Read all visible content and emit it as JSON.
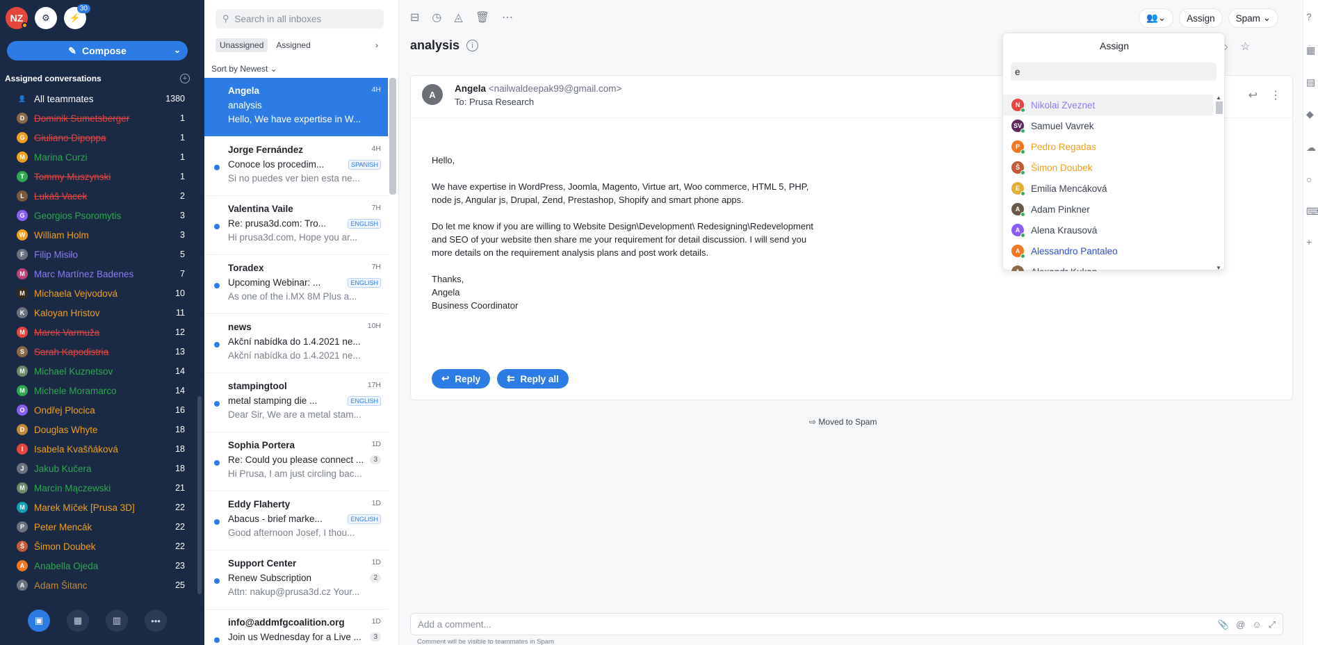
{
  "user": {
    "initials": "NZ",
    "bolt_badge": "30"
  },
  "compose_label": "Compose",
  "assigned_header": "Assigned conversations",
  "teammates": [
    {
      "initial": "",
      "name": "All teammates",
      "count": "1380",
      "color": "#ffffff",
      "av": "#1b2a44",
      "strike": false
    },
    {
      "initial": "D",
      "name": "Dominik Sumetsberger",
      "count": "1",
      "color": "#e64540",
      "av": "#8a6a4a",
      "strike": true
    },
    {
      "initial": "G",
      "name": "Giuliano Dipoppa",
      "count": "1",
      "color": "#e64540",
      "av": "#f0a020",
      "strike": true
    },
    {
      "initial": "M",
      "name": "Marina Curzi",
      "count": "1",
      "color": "#2fa84f",
      "av": "#f0a020",
      "strike": false
    },
    {
      "initial": "T",
      "name": "Tommy Muszynski",
      "count": "1",
      "color": "#e64540",
      "av": "#2fa84f",
      "strike": true
    },
    {
      "initial": "L",
      "name": "Lukáš Vacek",
      "count": "2",
      "color": "#e64540",
      "av": "#7a5a3a",
      "strike": true
    },
    {
      "initial": "G",
      "name": "Georgios Psoromytis",
      "count": "3",
      "color": "#2fa84f",
      "av": "#8b5cf6",
      "strike": false
    },
    {
      "initial": "W",
      "name": "William Holm",
      "count": "3",
      "color": "#f0a020",
      "av": "#f0a020",
      "strike": false
    },
    {
      "initial": "F",
      "name": "Filip Misiło",
      "count": "5",
      "color": "#8b7cf6",
      "av": "#6b7280",
      "strike": false
    },
    {
      "initial": "M",
      "name": "Marc Martínez Badenes",
      "count": "7",
      "color": "#8b7cf6",
      "av": "#c2407a",
      "strike": false
    },
    {
      "initial": "M",
      "name": "Michaela Vejvodová",
      "count": "10",
      "color": "#f0a020",
      "av": "#3a2a1a",
      "strike": false
    },
    {
      "initial": "K",
      "name": "Kaloyan Hristov",
      "count": "11",
      "color": "#f0a020",
      "av": "#6b7280",
      "strike": false
    },
    {
      "initial": "M",
      "name": "Marek Varmuža",
      "count": "12",
      "color": "#e64540",
      "av": "#e64540",
      "strike": true
    },
    {
      "initial": "S",
      "name": "Sarah Kapodistria",
      "count": "13",
      "color": "#e64540",
      "av": "#8a6a4a",
      "strike": true
    },
    {
      "initial": "M",
      "name": "Michael Kuznetsov",
      "count": "14",
      "color": "#2fa84f",
      "av": "#6b8a6a",
      "strike": false
    },
    {
      "initial": "M",
      "name": "Michele Moramarco",
      "count": "14",
      "color": "#2fa84f",
      "av": "#2fa84f",
      "strike": false
    },
    {
      "initial": "O",
      "name": "Ondřej Plocica",
      "count": "16",
      "color": "#f0a020",
      "av": "#8b5cf6",
      "strike": false
    },
    {
      "initial": "D",
      "name": "Douglas Whyte",
      "count": "18",
      "color": "#f0a020",
      "av": "#c28a3a",
      "strike": false
    },
    {
      "initial": "I",
      "name": "Isabela Kvašňáková",
      "count": "18",
      "color": "#f0a020",
      "av": "#e64540",
      "strike": false
    },
    {
      "initial": "J",
      "name": "Jakub Kučera",
      "count": "18",
      "color": "#2fa84f",
      "av": "#6b7280",
      "strike": false
    },
    {
      "initial": "M",
      "name": "Marcin Mączewski",
      "count": "21",
      "color": "#2fa84f",
      "av": "#6b8a6a",
      "strike": false
    },
    {
      "initial": "M",
      "name": "Marek Míček [Prusa 3D]",
      "count": "22",
      "color": "#f0a020",
      "av": "#14a0b4",
      "strike": false
    },
    {
      "initial": "P",
      "name": "Peter Mencák",
      "count": "22",
      "color": "#f0a020",
      "av": "#6b7280",
      "strike": false
    },
    {
      "initial": "Š",
      "name": "Šimon Doubek",
      "count": "22",
      "color": "#f0a020",
      "av": "#c25a3a",
      "strike": false
    },
    {
      "initial": "A",
      "name": "Anabella Ojeda",
      "count": "23",
      "color": "#2fa84f",
      "av": "#f07820",
      "strike": false
    },
    {
      "initial": "A",
      "name": "Adam Šitanc",
      "count": "25",
      "color": "#c28a3a",
      "av": "#6b7280",
      "strike": false
    }
  ],
  "search_placeholder": "Search in all inboxes",
  "filter_tabs": [
    "Unassigned",
    "Assigned"
  ],
  "sort_label": "Sort by Newest",
  "conversations": [
    {
      "from": "Angela",
      "time": "4H",
      "subject": "analysis",
      "preview": "Hello, We have expertise in W...",
      "tag": "",
      "count": "",
      "selected": true,
      "unread": false
    },
    {
      "from": "Jorge Fernández",
      "time": "4H",
      "subject": "Conoce los procedim...",
      "preview": "Si no puedes ver bien esta ne...",
      "tag": "SPANISH",
      "count": "",
      "selected": false,
      "unread": true
    },
    {
      "from": "Valentina Vaile",
      "time": "7H",
      "subject": "Re: prusa3d.com: Tro...",
      "preview": "Hi prusa3d.com, Hope you ar...",
      "tag": "ENGLISH",
      "count": "",
      "selected": false,
      "unread": true
    },
    {
      "from": "Toradex",
      "time": "7H",
      "subject": "Upcoming Webinar: ...",
      "preview": "As one of the i.MX 8M Plus a...",
      "tag": "ENGLISH",
      "count": "",
      "selected": false,
      "unread": true
    },
    {
      "from": "news",
      "time": "10H",
      "subject": "Akční nabídka do 1.4.2021 ne...",
      "preview": "Akční nabídka do 1.4.2021 ne...",
      "tag": "",
      "count": "",
      "selected": false,
      "unread": true
    },
    {
      "from": "stampingtool",
      "time": "17H",
      "subject": "metal stamping die ...",
      "preview": "Dear Sir, We are a metal stam...",
      "tag": "ENGLISH",
      "count": "",
      "selected": false,
      "unread": true
    },
    {
      "from": "Sophia Portera",
      "time": "1D",
      "subject": "Re: Could you please connect ...",
      "preview": "Hi Prusa, I am just circling bac...",
      "tag": "",
      "count": "3",
      "selected": false,
      "unread": true
    },
    {
      "from": "Eddy Flaherty",
      "time": "1D",
      "subject": "Abacus - brief marke...",
      "preview": "Good afternoon Josef, I thou...",
      "tag": "ENGLISH",
      "count": "",
      "selected": false,
      "unread": true
    },
    {
      "from": "Support Center",
      "time": "1D",
      "subject": "Renew Subscription",
      "preview": "Attn: nakup@prusa3d.cz Your...",
      "tag": "",
      "count": "2",
      "selected": false,
      "unread": true
    },
    {
      "from": "info@addmfgcoalition.org",
      "time": "1D",
      "subject": "Join us Wednesday for a Live ...",
      "preview": "",
      "tag": "",
      "count": "3",
      "selected": false,
      "unread": true
    }
  ],
  "conversation_title": "analysis",
  "top_actions": {
    "assign": "Assign",
    "spam": "Spam"
  },
  "message": {
    "sender_initial": "A",
    "sender_name": "Angela",
    "sender_email": "<nailwaldeepak99@gmail.com>",
    "to": "To: Prusa Research",
    "greeting": "Hello,",
    "p1": "We have expertise in WordPress, Joomla, Magento, Virtue art, Woo commerce, HTML 5, PHP, node js, Angular js, Drupal, Zend, Prestashop, Shopify and smart phone apps.",
    "p2": "Do let me know if you are willing to Website Design\\Development\\ Redesigning\\Redevelopment and SEO of your website then share me your requirement for detail discussion. I will send you more details on the requirement analysis plans and post work details.",
    "sign1": "Thanks,",
    "sign2": "Angela",
    "sign3": "Business Coordinator",
    "reply": "Reply",
    "reply_all": "Reply all"
  },
  "moved_note": "Moved to Spam",
  "comment_placeholder": "Add a comment...",
  "comment_note": "Comment will be visible to teammates in Spam",
  "assign_dropdown": {
    "title": "Assign",
    "query": "e",
    "options": [
      {
        "initial": "N",
        "name": "Nikolai Zveznet",
        "color": "#8b7cf6",
        "av": "#e64540",
        "hl": true
      },
      {
        "initial": "SV",
        "name": "Samuel Vavrek",
        "color": "#3b4350",
        "av": "#5a2a5a",
        "hl": false
      },
      {
        "initial": "P",
        "name": "Pedro Regadas",
        "color": "#f0a020",
        "av": "#f07820",
        "hl": false
      },
      {
        "initial": "Š",
        "name": "Šimon Doubek",
        "color": "#f0a020",
        "av": "#c25a3a",
        "hl": false
      },
      {
        "initial": "E",
        "name": "Emilia Mencáková",
        "color": "#3b4350",
        "av": "#e0b030",
        "hl": false
      },
      {
        "initial": "A",
        "name": "Adam Pinkner",
        "color": "#3b4350",
        "av": "#6b5a4a",
        "hl": false
      },
      {
        "initial": "A",
        "name": "Alena Krausová",
        "color": "#3b4350",
        "av": "#8b5cf6",
        "hl": false
      },
      {
        "initial": "A",
        "name": "Alessandro Pantaleo",
        "color": "#2d4fd0",
        "av": "#f07820",
        "hl": false
      },
      {
        "initial": "A",
        "name": "Alexandr Kukan",
        "color": "#3b4350",
        "av": "#8a6a4a",
        "hl": false
      }
    ]
  }
}
